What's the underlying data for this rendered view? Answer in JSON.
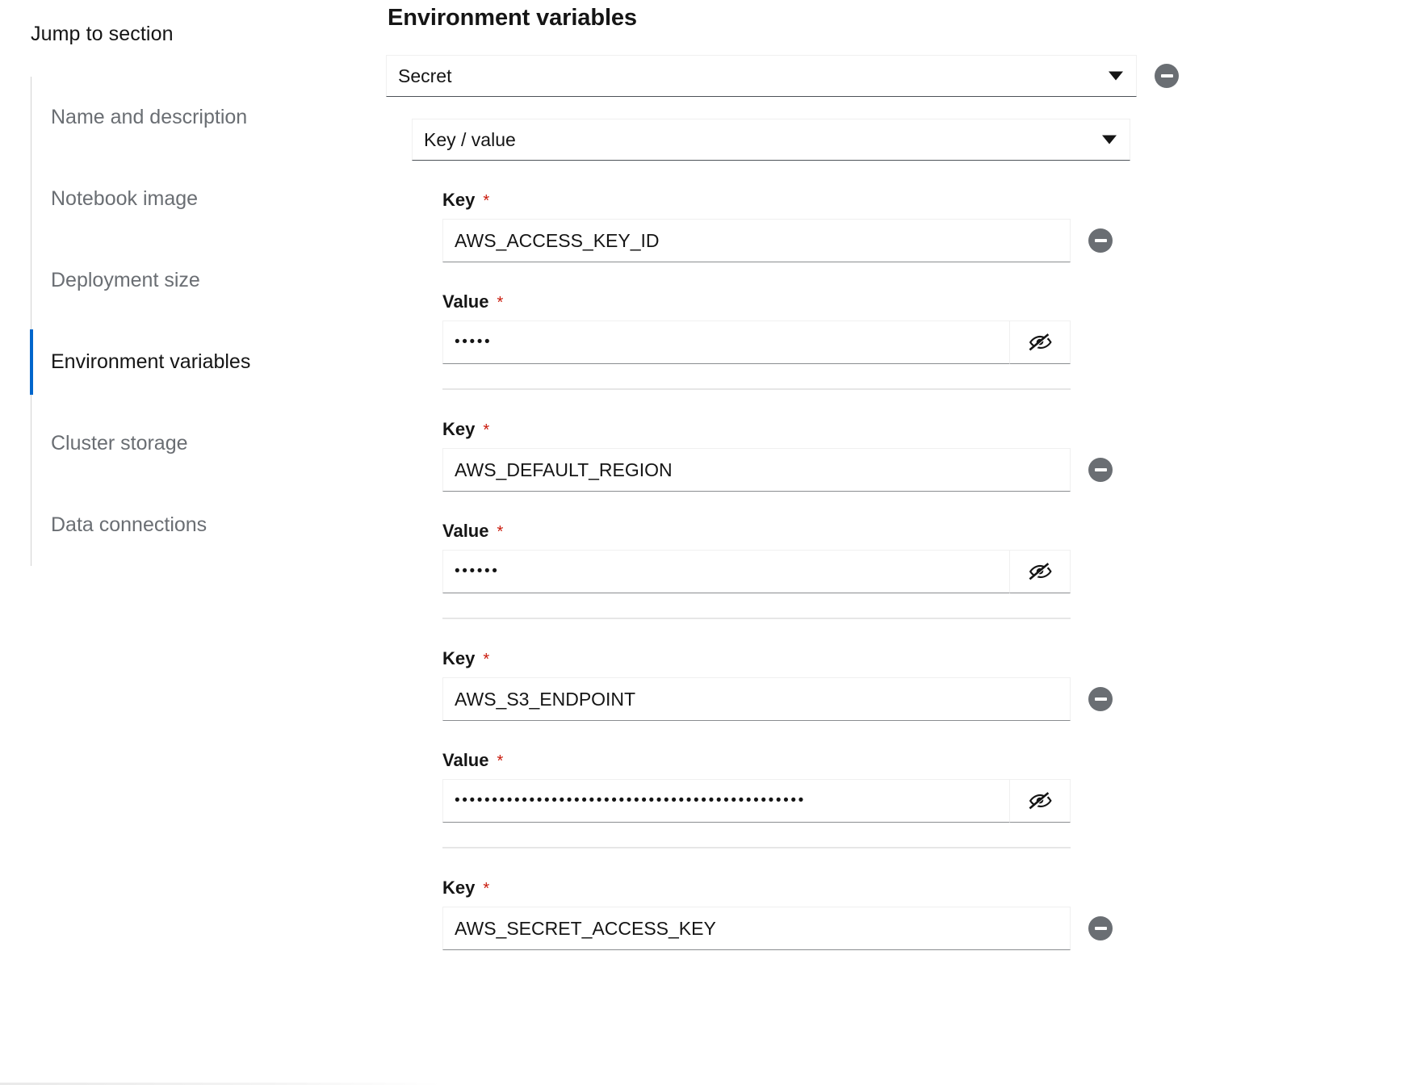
{
  "sidebar": {
    "title": "Jump to section",
    "items": [
      {
        "label": "Name and description",
        "active": false
      },
      {
        "label": "Notebook image",
        "active": false
      },
      {
        "label": "Deployment size",
        "active": false
      },
      {
        "label": "Environment variables",
        "active": true
      },
      {
        "label": "Cluster storage",
        "active": false
      },
      {
        "label": "Data connections",
        "active": false
      }
    ]
  },
  "main": {
    "section_title": "Environment variables",
    "type_select": {
      "value": "Secret",
      "icon": "chevron-down-icon"
    },
    "mode_select": {
      "value": "Key / value",
      "icon": "chevron-down-icon"
    },
    "remove_icon": "minus-circle-icon",
    "labels": {
      "key": "Key",
      "value": "Value",
      "required_mark": "*"
    },
    "password_toggle_icon": "eye-slash-icon",
    "variables": [
      {
        "key": "AWS_ACCESS_KEY_ID",
        "value_masked": "•••••"
      },
      {
        "key": "AWS_DEFAULT_REGION",
        "value_masked": "••••••"
      },
      {
        "key": "AWS_S3_ENDPOINT",
        "value_masked": "•••••••••••••••••••••••••••••••••••••••••••••••"
      },
      {
        "key": "AWS_SECRET_ACCESS_KEY",
        "value_masked": ""
      }
    ]
  },
  "colors": {
    "accent": "#0066cc",
    "required": "#c9190b",
    "muted_text": "#6a6e73",
    "remove_button": "#6a6e73"
  }
}
